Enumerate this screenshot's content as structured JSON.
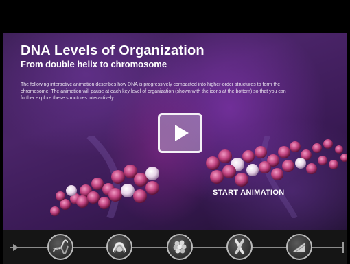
{
  "main": {
    "title": "DNA Levels of Organization",
    "subtitle": "From double helix to chromosome",
    "description": "The following interactive animation describes how DNA is progressively compacted into higher-order structures to form the chromosome. The animation will pause at each key level of organization (shown with the icons at the bottom) so that you can further explore these structures interactively.",
    "start_label": "START ANIMATION"
  },
  "icons": {
    "play": "play-icon",
    "levels": [
      "double-helix-icon",
      "nucleosome-icon",
      "chromatin-fiber-icon",
      "chromosome-icon",
      "looped-domain-icon"
    ]
  },
  "colors": {
    "background": "#000000",
    "stage_purple": "#4a2468",
    "helix_pink": "#c0427f",
    "bar": "#151515"
  }
}
